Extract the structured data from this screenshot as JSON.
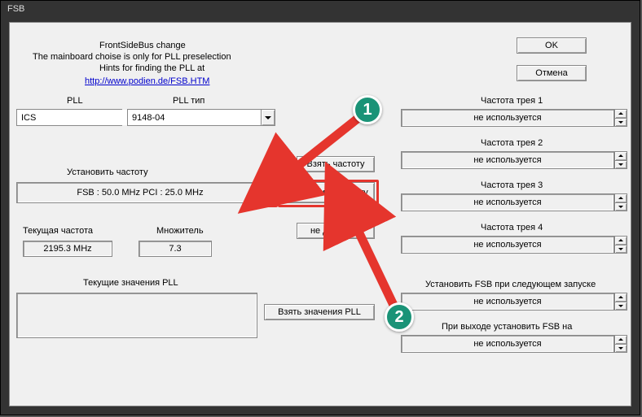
{
  "window": {
    "title": "FSB"
  },
  "header": {
    "line1": "FrontSideBus change",
    "line2": "The mainboard choise is only for PLL preselection",
    "line3": "Hints for finding the PLL at",
    "link": "http://www.podien.de/FSB.HTM"
  },
  "labels": {
    "pll": "PLL",
    "pll_type": "PLL тип",
    "set_freq": "Установить частоту",
    "cur_freq": "Текущая частота",
    "multiplier": "Множитель",
    "cur_pll": "Текущие значения PLL"
  },
  "combos": {
    "pll": "ICS",
    "pll_type": "9148-04"
  },
  "fsb": {
    "value": "FSB :   50.0 MHz  PCI :    25.0 MHz"
  },
  "values": {
    "cur_freq": "2195.3 MHz",
    "multiplier": "7.3",
    "cur_pll": ""
  },
  "buttons": {
    "ok": "OK",
    "cancel": "Отмена",
    "get_freq": "Взять частоту",
    "set_freq": "Установить частоту",
    "not_avail": "не доступно",
    "get_pll": "Взять значения PLL"
  },
  "trays": {
    "unused": "не используется",
    "t1": "Частота трея 1",
    "t2": "Частота трея 2",
    "t3": "Частота трея 3",
    "t4": "Частота трея 4",
    "boot": "Установить FSB при следующем запуске",
    "exit": "При выходе установить FSB на"
  },
  "annotations": {
    "m1": "1",
    "m2": "2"
  }
}
